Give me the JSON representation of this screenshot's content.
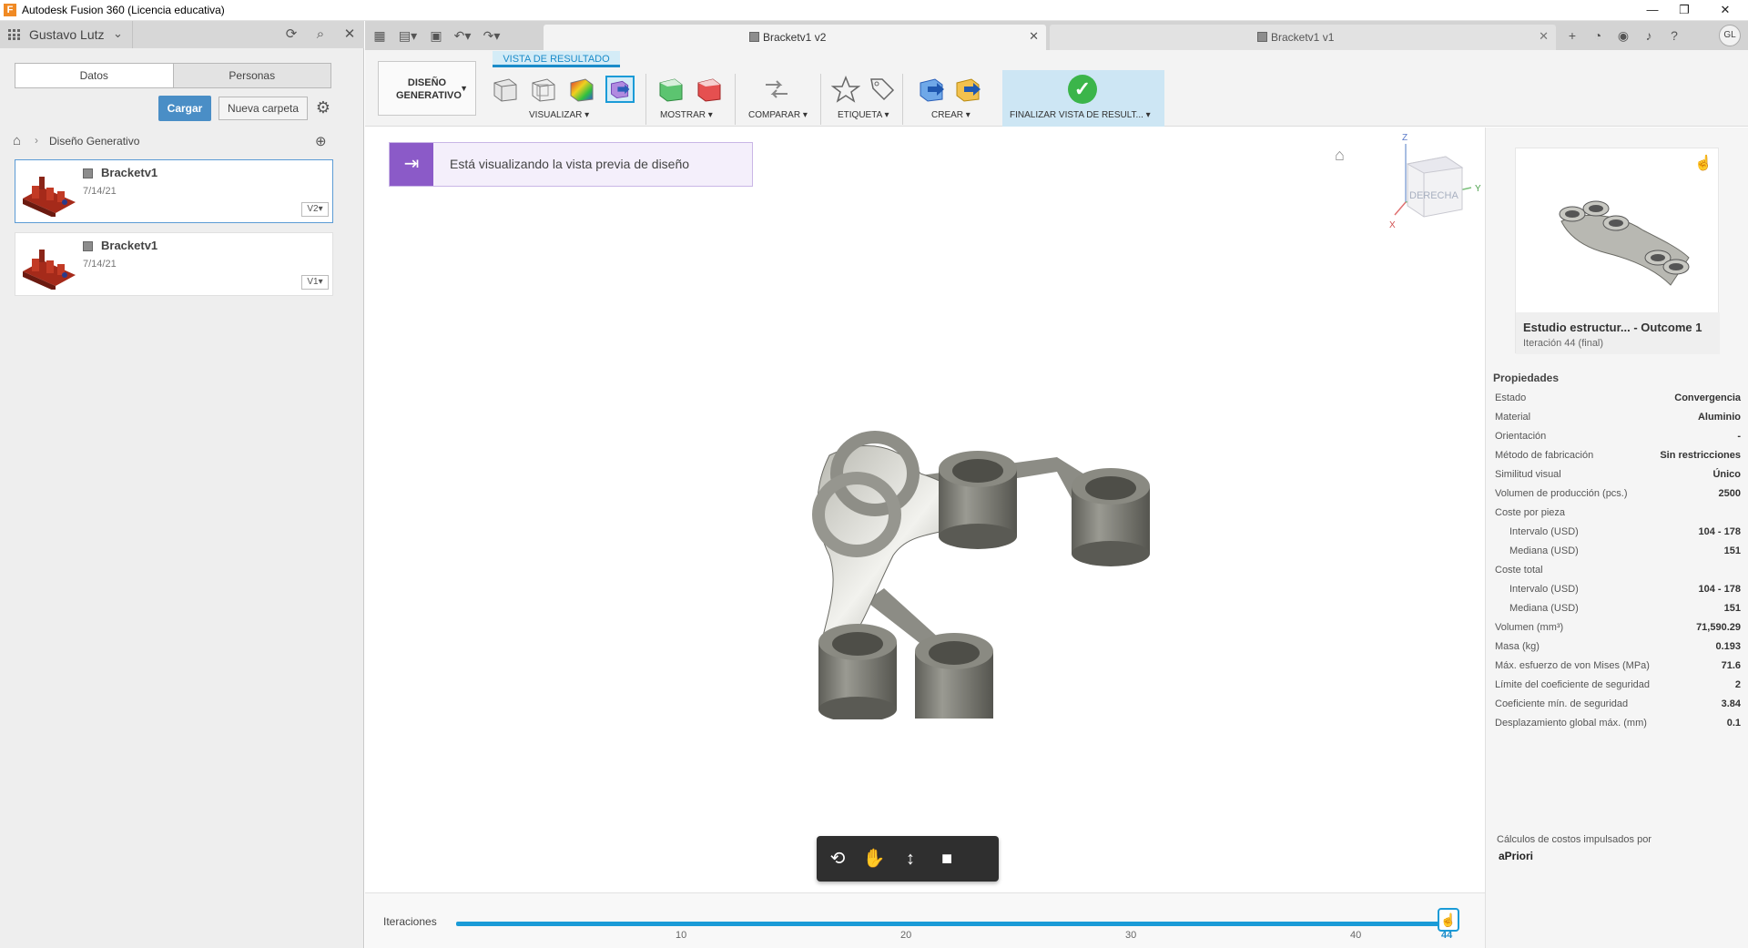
{
  "window": {
    "title": "Autodesk Fusion 360 (Licencia educativa)",
    "app_icon": "F",
    "controls": [
      "—",
      "❐",
      "✕"
    ]
  },
  "data_panel": {
    "user": "Gustavo Lutz",
    "tabs": [
      "Datos",
      "Personas"
    ],
    "upload_label": "Cargar",
    "new_folder_label": "Nueva carpeta",
    "breadcrumb": "Diseño Generativo",
    "files": [
      {
        "name": "Bracketv1",
        "date": "7/14/21",
        "version": "V2▾"
      },
      {
        "name": "Bracketv1",
        "date": "7/14/21",
        "version": "V1▾"
      }
    ]
  },
  "tabbar": {
    "active_tab": "Bracketv1 v2",
    "second_tab": "Bracketv1 v1",
    "avatar_initials": "GL"
  },
  "toolbar": {
    "workspace": "DISEÑO GENERATIVO",
    "context_tag": "VISTA DE RESULTADO",
    "groups": {
      "visualize": "VISUALIZAR ▾",
      "show": "MOSTRAR ▾",
      "compare": "COMPARAR ▾",
      "label": "ETIQUETA ▾",
      "create": "CREAR ▾",
      "finish": "FINALIZAR VISTA DE RESULT... ▾"
    }
  },
  "viewport": {
    "banner_text": "Está visualizando la vista previa de diseño",
    "viewcube_face": "DERECHA",
    "axis_labels": {
      "z": "Z",
      "y": "Y",
      "x": "X"
    }
  },
  "iterations": {
    "label": "Iteraciones",
    "ticks": [
      "10",
      "20",
      "30",
      "40"
    ],
    "current": "44",
    "position_fraction": 1.0
  },
  "outcome": {
    "title": "Estudio estructur... - Outcome 1",
    "subtitle": "Iteración 44 (final)",
    "properties_title": "Propiedades",
    "properties": [
      {
        "key": "Estado",
        "value": "Convergencia"
      },
      {
        "key": "Material",
        "value": "Aluminio"
      },
      {
        "key": "Orientación",
        "value": "-"
      },
      {
        "key": "Método de fabricación",
        "value": "Sin restricciones"
      },
      {
        "key": "Similitud visual",
        "value": "Único"
      },
      {
        "key": "Volumen de producción (pcs.)",
        "value": "2500"
      },
      {
        "key": "Coste por pieza",
        "value": ""
      },
      {
        "key": "Intervalo (USD)",
        "value": "104 - 178",
        "indent": true
      },
      {
        "key": "Mediana (USD)",
        "value": "151",
        "indent": true
      },
      {
        "key": "Coste total",
        "value": ""
      },
      {
        "key": "Intervalo (USD)",
        "value": "104 - 178",
        "indent": true
      },
      {
        "key": "Mediana (USD)",
        "value": "151",
        "indent": true
      },
      {
        "key": "Volumen (mm³)",
        "value": "71,590.29"
      },
      {
        "key": "Masa (kg)",
        "value": "0.193"
      },
      {
        "key": "Máx. esfuerzo de von Mises (MPa)",
        "value": "71.6"
      },
      {
        "key": "Límite del coeficiente de seguridad",
        "value": "2"
      },
      {
        "key": "Coeficiente mín. de seguridad",
        "value": "3.84"
      },
      {
        "key": "Desplazamiento global máx. (mm)",
        "value": "0.1"
      }
    ],
    "credit": "Cálculos de costos impulsados por",
    "credit_brand": "aPriori"
  },
  "colors": {
    "accent": "#1a9bd7",
    "primary_button": "#4a8ec6",
    "banner_purple": "#8b5ac8",
    "finish_green": "#3bb54a"
  }
}
